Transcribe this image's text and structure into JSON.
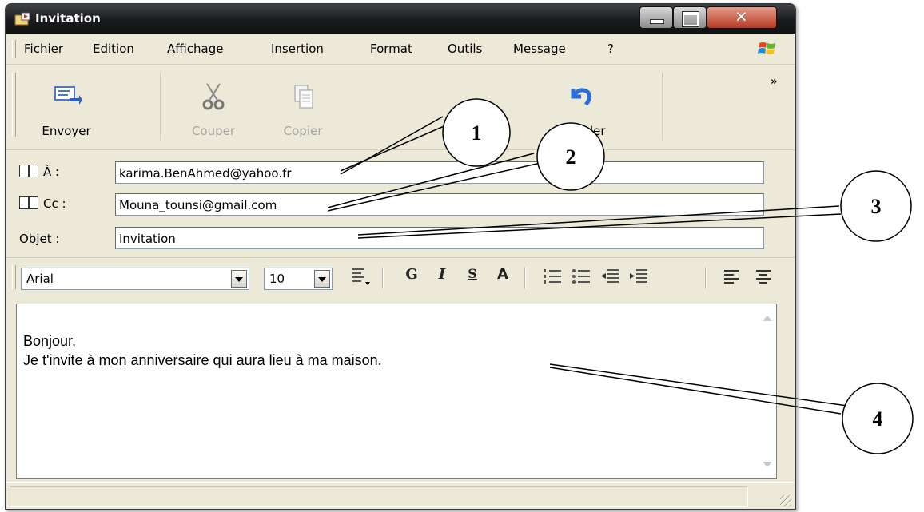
{
  "window": {
    "title": "Invitation"
  },
  "menu": [
    "Fichier",
    "Edition",
    "Affichage",
    "Insertion",
    "Format",
    "Outils",
    "Message",
    "?"
  ],
  "toolbar": {
    "send": "Envoyer",
    "cut": "Couper",
    "copy": "Copier",
    "undo_partial": "ler",
    "more": "»"
  },
  "headers": {
    "to_label": "À :",
    "to_value": "karima.BenAhmed@yahoo.fr",
    "cc_label": "Cc :",
    "cc_value": "Mouna_tounsi@gmail.com",
    "subject_label": "Objet :",
    "subject_value": "Invitation"
  },
  "format": {
    "font": "Arial",
    "size": "10",
    "bold": "G",
    "italic": "I",
    "underline": "S",
    "font_color": "A"
  },
  "body": {
    "line1": "Bonjour,",
    "line2": "Je t'invite à mon anniversaire qui aura lieu à ma maison."
  },
  "callouts": [
    "1",
    "2",
    "3",
    "4"
  ],
  "icons": {
    "send": "send-envelope-icon",
    "cut": "scissors-icon",
    "copy": "copy-icon",
    "undo": "undo-arrow-icon",
    "windows_logo": "windows-flag-icon",
    "address_book": "address-book-icon"
  }
}
